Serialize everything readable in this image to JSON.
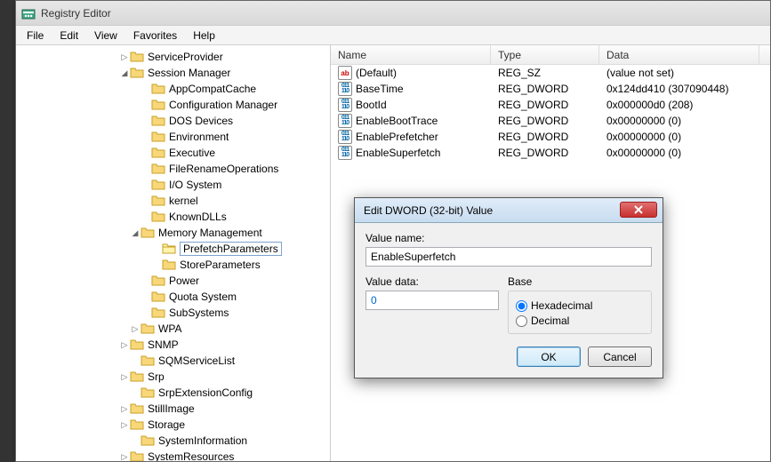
{
  "window": {
    "title": "Registry Editor"
  },
  "menu": {
    "file": "File",
    "edit": "Edit",
    "view": "View",
    "favorites": "Favorites",
    "help": "Help"
  },
  "tree": {
    "items": [
      {
        "indent": 116,
        "exp": "▷",
        "label": "ServiceProvider"
      },
      {
        "indent": 116,
        "exp": "◢",
        "label": "Session Manager"
      },
      {
        "indent": 140,
        "exp": "",
        "label": "AppCompatCache"
      },
      {
        "indent": 140,
        "exp": "",
        "label": "Configuration Manager"
      },
      {
        "indent": 140,
        "exp": "",
        "label": "DOS Devices"
      },
      {
        "indent": 140,
        "exp": "",
        "label": "Environment"
      },
      {
        "indent": 140,
        "exp": "",
        "label": "Executive"
      },
      {
        "indent": 140,
        "exp": "",
        "label": "FileRenameOperations"
      },
      {
        "indent": 140,
        "exp": "",
        "label": "I/O System"
      },
      {
        "indent": 140,
        "exp": "",
        "label": "kernel"
      },
      {
        "indent": 140,
        "exp": "",
        "label": "KnownDLLs"
      },
      {
        "indent": 128,
        "exp": "◢",
        "label": "Memory Management"
      },
      {
        "indent": 152,
        "exp": "",
        "label": "PrefetchParameters",
        "selected": true,
        "open": true
      },
      {
        "indent": 152,
        "exp": "",
        "label": "StoreParameters"
      },
      {
        "indent": 140,
        "exp": "",
        "label": "Power"
      },
      {
        "indent": 140,
        "exp": "",
        "label": "Quota System"
      },
      {
        "indent": 140,
        "exp": "",
        "label": "SubSystems"
      },
      {
        "indent": 128,
        "exp": "▷",
        "label": "WPA"
      },
      {
        "indent": 116,
        "exp": "▷",
        "label": "SNMP"
      },
      {
        "indent": 128,
        "exp": "",
        "label": "SQMServiceList"
      },
      {
        "indent": 116,
        "exp": "▷",
        "label": "Srp"
      },
      {
        "indent": 128,
        "exp": "",
        "label": "SrpExtensionConfig"
      },
      {
        "indent": 116,
        "exp": "▷",
        "label": "StillImage"
      },
      {
        "indent": 116,
        "exp": "▷",
        "label": "Storage"
      },
      {
        "indent": 128,
        "exp": "",
        "label": "SystemInformation"
      },
      {
        "indent": 116,
        "exp": "▷",
        "label": "SystemResources"
      }
    ]
  },
  "list": {
    "headers": {
      "name": "Name",
      "type": "Type",
      "data": "Data"
    },
    "cols": {
      "name": 180,
      "type": 122,
      "data": 180
    },
    "rows": [
      {
        "icon": "ab",
        "name": "(Default)",
        "type": "REG_SZ",
        "data": "(value not set)"
      },
      {
        "icon": "bin",
        "name": "BaseTime",
        "type": "REG_DWORD",
        "data": "0x124dd410 (307090448)"
      },
      {
        "icon": "bin",
        "name": "BootId",
        "type": "REG_DWORD",
        "data": "0x000000d0 (208)"
      },
      {
        "icon": "bin",
        "name": "EnableBootTrace",
        "type": "REG_DWORD",
        "data": "0x00000000 (0)"
      },
      {
        "icon": "bin",
        "name": "EnablePrefetcher",
        "type": "REG_DWORD",
        "data": "0x00000000 (0)"
      },
      {
        "icon": "bin",
        "name": "EnableSuperfetch",
        "type": "REG_DWORD",
        "data": "0x00000000 (0)"
      }
    ]
  },
  "dialog": {
    "title": "Edit DWORD (32-bit) Value",
    "value_name_label": "Value name:",
    "value_name": "EnableSuperfetch",
    "value_data_label": "Value data:",
    "value_data": "0",
    "base_label": "Base",
    "hex_label": "Hexadecimal",
    "dec_label": "Decimal",
    "ok": "OK",
    "cancel": "Cancel"
  }
}
